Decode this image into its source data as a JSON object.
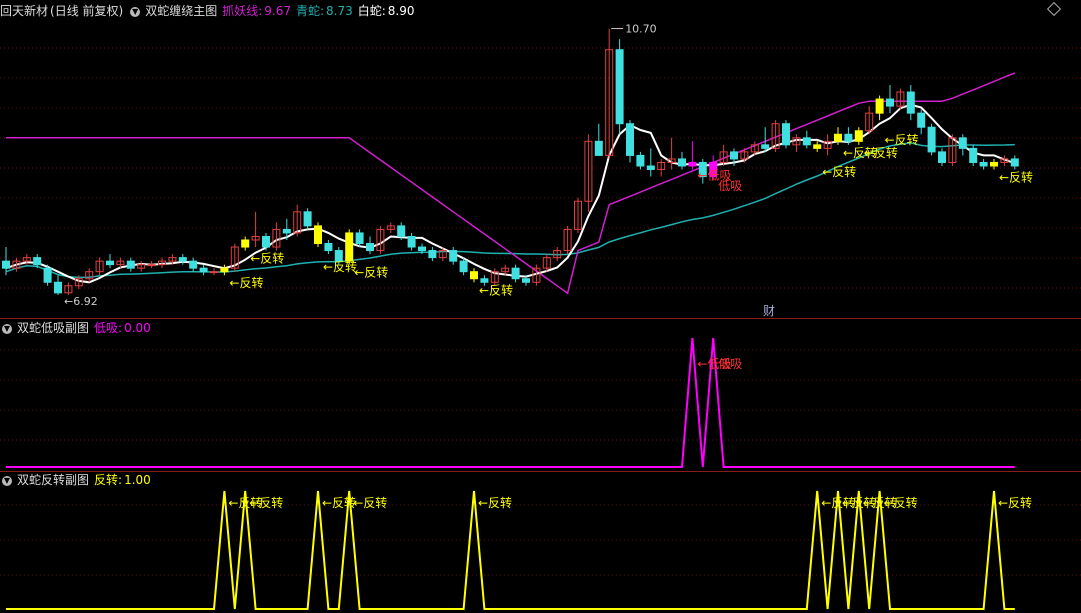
{
  "main_panel": {
    "stock": "回天新材",
    "mode": "(日线 前复权)",
    "indicator": "双蛇缠绕主图",
    "zhuayao_label": "抓妖线:",
    "zhuayao_value": "9.67",
    "qingshe_label": "青蛇:",
    "qingshe_value": "8.73",
    "baishe_label": "白蛇:",
    "baishe_value": "8.90",
    "high_label": "10.70",
    "low_label": "6.92",
    "cai_marker": "财",
    "colors": {
      "zhuayao": "#d020d0",
      "qingshe": "#20b0b0",
      "baishe": "#ffffff",
      "up": "#e04040",
      "down": "#40e0e0",
      "signal_fz": "#ffff00",
      "signal_dx": "#ff00ff"
    }
  },
  "sub1": {
    "indicator": "双蛇低吸副图",
    "label": "低吸:",
    "value": "0.00",
    "color": "#ff00ff"
  },
  "sub2": {
    "indicator": "双蛇反转副图",
    "label": "反转:",
    "value": "1.00",
    "color": "#ffff00"
  },
  "annotations": {
    "fanzhuan": "←反转",
    "dixi": "←低吸",
    "dixi2": "低吸"
  },
  "chart_data": {
    "type": "candlestick",
    "candles": [
      [
        7.4,
        7.6,
        7.2,
        7.3
      ],
      [
        7.3,
        7.45,
        7.25,
        7.4
      ],
      [
        7.4,
        7.5,
        7.35,
        7.45
      ],
      [
        7.45,
        7.5,
        7.3,
        7.35
      ],
      [
        7.3,
        7.35,
        7.05,
        7.1
      ],
      [
        7.1,
        7.2,
        6.92,
        6.95
      ],
      [
        6.95,
        7.1,
        6.92,
        7.05
      ],
      [
        7.05,
        7.2,
        7.0,
        7.15
      ],
      [
        7.15,
        7.3,
        7.1,
        7.25
      ],
      [
        7.25,
        7.45,
        7.2,
        7.4
      ],
      [
        7.4,
        7.5,
        7.3,
        7.35
      ],
      [
        7.35,
        7.45,
        7.3,
        7.4
      ],
      [
        7.4,
        7.45,
        7.25,
        7.3
      ],
      [
        7.3,
        7.4,
        7.25,
        7.35
      ],
      [
        7.35,
        7.4,
        7.3,
        7.35
      ],
      [
        7.35,
        7.45,
        7.3,
        7.4
      ],
      [
        7.4,
        7.5,
        7.35,
        7.45
      ],
      [
        7.45,
        7.5,
        7.35,
        7.4
      ],
      [
        7.4,
        7.45,
        7.25,
        7.3
      ],
      [
        7.3,
        7.35,
        7.2,
        7.25
      ],
      [
        7.25,
        7.3,
        7.2,
        7.25
      ],
      [
        7.25,
        7.35,
        7.2,
        7.3
      ],
      [
        7.3,
        7.65,
        7.25,
        7.6
      ],
      [
        7.6,
        7.75,
        7.55,
        7.7
      ],
      [
        7.7,
        8.1,
        7.6,
        7.75
      ],
      [
        7.75,
        7.8,
        7.55,
        7.6
      ],
      [
        7.6,
        7.95,
        7.55,
        7.85
      ],
      [
        7.85,
        8.0,
        7.7,
        7.8
      ],
      [
        7.8,
        8.2,
        7.75,
        8.1
      ],
      [
        8.1,
        8.15,
        7.85,
        7.9
      ],
      [
        7.9,
        7.95,
        7.6,
        7.65
      ],
      [
        7.65,
        7.7,
        7.5,
        7.55
      ],
      [
        7.55,
        7.6,
        7.35,
        7.4
      ],
      [
        7.4,
        7.85,
        7.35,
        7.8
      ],
      [
        7.8,
        7.85,
        7.6,
        7.65
      ],
      [
        7.65,
        7.75,
        7.5,
        7.55
      ],
      [
        7.55,
        7.9,
        7.5,
        7.85
      ],
      [
        7.85,
        7.95,
        7.8,
        7.9
      ],
      [
        7.9,
        7.95,
        7.7,
        7.75
      ],
      [
        7.75,
        7.8,
        7.55,
        7.6
      ],
      [
        7.6,
        7.65,
        7.5,
        7.55
      ],
      [
        7.55,
        7.6,
        7.4,
        7.45
      ],
      [
        7.45,
        7.6,
        7.4,
        7.55
      ],
      [
        7.55,
        7.6,
        7.35,
        7.4
      ],
      [
        7.4,
        7.45,
        7.2,
        7.25
      ],
      [
        7.25,
        7.3,
        7.1,
        7.15
      ],
      [
        7.15,
        7.2,
        7.05,
        7.1
      ],
      [
        7.1,
        7.3,
        7.05,
        7.25
      ],
      [
        7.25,
        7.35,
        7.2,
        7.3
      ],
      [
        7.3,
        7.35,
        7.1,
        7.15
      ],
      [
        7.15,
        7.2,
        7.05,
        7.1
      ],
      [
        7.1,
        7.35,
        7.05,
        7.3
      ],
      [
        7.3,
        7.5,
        7.25,
        7.45
      ],
      [
        7.45,
        7.6,
        7.4,
        7.55
      ],
      [
        7.55,
        7.9,
        7.5,
        7.85
      ],
      [
        7.85,
        8.3,
        7.8,
        8.25
      ],
      [
        8.25,
        9.2,
        8.1,
        9.1
      ],
      [
        9.1,
        9.35,
        8.9,
        8.9
      ],
      [
        8.9,
        10.7,
        8.85,
        10.4
      ],
      [
        10.4,
        10.55,
        9.2,
        9.35
      ],
      [
        9.35,
        9.4,
        8.8,
        8.9
      ],
      [
        8.9,
        8.95,
        8.7,
        8.75
      ],
      [
        8.75,
        9.0,
        8.6,
        8.7
      ],
      [
        8.7,
        8.85,
        8.6,
        8.8
      ],
      [
        8.8,
        9.15,
        8.7,
        8.85
      ],
      [
        8.85,
        8.95,
        8.7,
        8.75
      ],
      [
        8.75,
        9.1,
        8.7,
        8.8
      ],
      [
        8.8,
        8.85,
        8.5,
        8.6
      ],
      [
        8.6,
        8.9,
        8.55,
        8.8
      ],
      [
        8.8,
        9.05,
        8.75,
        8.95
      ],
      [
        8.95,
        9.0,
        8.75,
        8.85
      ],
      [
        8.85,
        9.0,
        8.8,
        8.95
      ],
      [
        8.95,
        9.1,
        8.9,
        9.05
      ],
      [
        9.05,
        9.3,
        8.95,
        9.0
      ],
      [
        9.0,
        9.4,
        8.95,
        9.35
      ],
      [
        9.35,
        9.4,
        9.0,
        9.05
      ],
      [
        9.05,
        9.2,
        8.95,
        9.15
      ],
      [
        9.15,
        9.25,
        9.0,
        9.05
      ],
      [
        9.05,
        9.1,
        8.95,
        9.0
      ],
      [
        9.0,
        9.2,
        8.9,
        9.1
      ],
      [
        9.1,
        9.3,
        9.05,
        9.2
      ],
      [
        9.2,
        9.3,
        9.05,
        9.1
      ],
      [
        9.1,
        9.3,
        9.05,
        9.25
      ],
      [
        9.25,
        9.6,
        9.2,
        9.5
      ],
      [
        9.5,
        9.75,
        9.4,
        9.7
      ],
      [
        9.7,
        9.9,
        9.5,
        9.6
      ],
      [
        9.6,
        9.85,
        9.55,
        9.8
      ],
      [
        9.8,
        9.9,
        9.4,
        9.5
      ],
      [
        9.5,
        9.55,
        9.2,
        9.3
      ],
      [
        9.3,
        9.35,
        8.9,
        8.95
      ],
      [
        8.95,
        9.0,
        8.75,
        8.8
      ],
      [
        8.8,
        9.2,
        8.75,
        9.15
      ],
      [
        9.15,
        9.2,
        8.9,
        9.0
      ],
      [
        9.0,
        9.05,
        8.75,
        8.8
      ],
      [
        8.8,
        8.85,
        8.7,
        8.75
      ],
      [
        8.75,
        8.85,
        8.7,
        8.8
      ],
      [
        8.8,
        8.9,
        8.75,
        8.85
      ],
      [
        8.85,
        8.9,
        8.7,
        8.75
      ]
    ],
    "zhuayao_line": [],
    "fanzhuan_signal_indices": [
      21,
      23,
      30,
      33,
      45,
      78,
      80,
      82,
      84,
      95
    ],
    "dixi_signal_indices": [
      66,
      68
    ]
  }
}
